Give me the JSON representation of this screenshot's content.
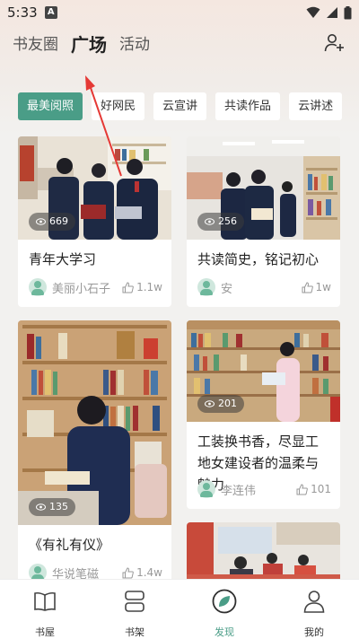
{
  "status": {
    "time": "5:33",
    "notif_letter": "A"
  },
  "top_tabs": [
    {
      "label": "书友圈"
    },
    {
      "label": "广场"
    },
    {
      "label": "活动"
    }
  ],
  "chips": [
    {
      "label": "最美阅照"
    },
    {
      "label": "好网民"
    },
    {
      "label": "云宣讲"
    },
    {
      "label": "共读作品"
    },
    {
      "label": "云讲述"
    }
  ],
  "cards": [
    {
      "views": "669",
      "title": "青年大学习",
      "author": "美丽小石子",
      "likes": "1.1w"
    },
    {
      "views": "256",
      "title": "共读简史，铭记初心",
      "author": "安",
      "likes": "1w"
    },
    {
      "views": "135",
      "title": "《有礼有仪》",
      "author": "华说笔磁",
      "likes": "1.4w"
    },
    {
      "views": "201",
      "title": "工装换书香，尽显工地女建设者的温柔与魅力",
      "author": "李连伟",
      "likes": "101"
    }
  ],
  "bottom_nav": [
    {
      "label": "书屋"
    },
    {
      "label": "书架"
    },
    {
      "label": "发现"
    },
    {
      "label": "我的"
    }
  ],
  "colors": {
    "accent": "#4a9d87",
    "annotation_arrow": "#e53935"
  }
}
